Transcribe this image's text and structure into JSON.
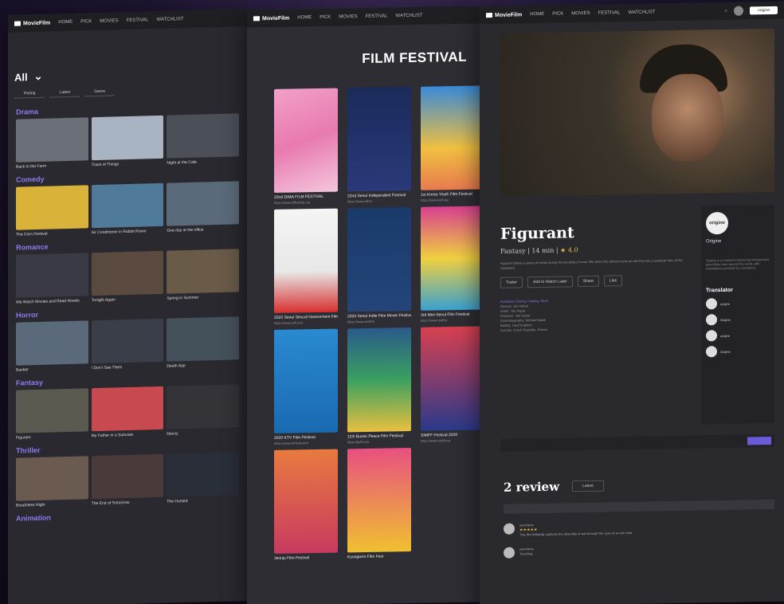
{
  "nav": {
    "brand": "MovieFilm",
    "menu": [
      "HOME",
      "PICK",
      "MOVIES",
      "FESTIVAL",
      "WATCHLIST"
    ],
    "search_placeholder": "origine"
  },
  "left": {
    "filter_label": "All",
    "subfilters": [
      "Rating",
      "Latest",
      "Genre"
    ],
    "genres": [
      {
        "name": "Drama",
        "items": [
          "Back to the Farm",
          "Trace of Things",
          "Night at the Cafe"
        ]
      },
      {
        "name": "Comedy",
        "items": [
          "The Corn Festival",
          "Air Conditioner in Rabbit Room",
          "One day at the office"
        ]
      },
      {
        "name": "Romance",
        "items": [
          "We Watch Movies and Read Novels",
          "Tonight Again",
          "Spring in Summer"
        ]
      },
      {
        "name": "Horror",
        "items": [
          "Banker",
          "I Don't See Them",
          "Death App"
        ]
      },
      {
        "name": "Fantasy",
        "items": [
          "Figurant",
          "My Father in a Suitcase",
          "Decoy"
        ]
      },
      {
        "name": "Thriller",
        "items": [
          "Breathless Night",
          "The End of Tomorrow",
          "The Hunted"
        ]
      },
      {
        "name": "Animation",
        "items": []
      }
    ]
  },
  "mid": {
    "title": "FILM FESTIVAL",
    "posters": [
      {
        "title": "22nd DIMA FILM FESTIVAL",
        "url": "https://www.diffestival.org"
      },
      {
        "title": "22nd Seoul Independent Festival",
        "url": "https://www.siff.kr"
      },
      {
        "title": "1st Korea Youth Film Festival",
        "url": "https://www.kyff.org"
      },
      {
        "title": "2020 Seoul Sexual Harassment Film Fest",
        "url": "https://www.ssff.or.kr"
      },
      {
        "title": "2020 Seoul Indie Film Movie Festival",
        "url": "https://www.simff.kr"
      },
      {
        "title": "3rd Mini Seoul Film Festival",
        "url": "https://www.msff.kr"
      },
      {
        "title": "2020 KTV Film Festival",
        "url": "https://www.ktvfestival.kr"
      },
      {
        "title": "11th Busan Peace Film Festival",
        "url": "https://bpff.or.kr"
      },
      {
        "title": "SIMFF Festival 2020",
        "url": "https://www.simff.org"
      },
      {
        "title": "Jeonju Film Festival",
        "url": ""
      },
      {
        "title": "Kyungwon Film Fest",
        "url": ""
      },
      {
        "title": "",
        "url": ""
      }
    ]
  },
  "right": {
    "film_title": "Figurant",
    "film_meta": "Fantasy | 14 min |",
    "rating": "★ 4.0",
    "synopsis": "Figurant follows a group of extras during the shooting of a war film where the director turns an old man into a symbolic hero of the resistance.",
    "actions": [
      "Trailer",
      "Add to Watch Later",
      "Share",
      "Like"
    ],
    "credits_tag": "Animation, Drama, Fantasy, Short",
    "credits": [
      "Director: Jan Vejnar",
      "Writer: Jan Vejnar",
      "Producer: Jan Vejnar",
      "Cinematography: Michael Malek",
      "Editing: Josef Krajbich",
      "Country: Czech Republic, France"
    ],
    "channel": {
      "logo": "origine",
      "name": "Origine",
      "desc": "Origine is a channel introducing independent short films from around the world, with translations provided by volunteers."
    },
    "translator_heading": "Translator",
    "translators": [
      "origine",
      "Origine",
      "origine",
      "Origine"
    ],
    "review_count": "2 review",
    "review_sort": "Latest",
    "reviews": [
      {
        "user": "username",
        "stars": "★★★★★",
        "text": "This film brilliantly captures the absurdity of war through the eyes of an old extra."
      },
      {
        "user": "username",
        "stars": "",
        "text": "Touching."
      }
    ]
  }
}
